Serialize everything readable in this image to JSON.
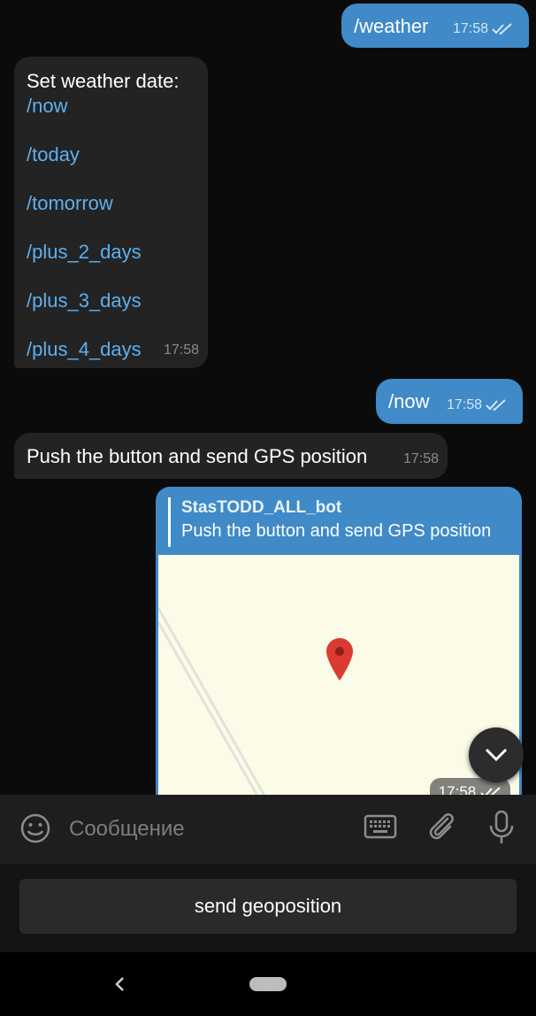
{
  "messages": {
    "m1": {
      "text": "/weather",
      "time": "17:58"
    },
    "m2": {
      "title": "Set weather date:",
      "commands": [
        "/now",
        "/today",
        "/tomorrow",
        "/plus_2_days",
        "/plus_3_days",
        "/plus_4_days"
      ],
      "time": "17:58"
    },
    "m3": {
      "text": "/now",
      "time": "17:58"
    },
    "m4": {
      "text": "Push the button and send GPS position",
      "time": "17:58"
    },
    "m5": {
      "reply_name": "StasTODD_ALL_bot",
      "reply_text": "Push the button and send GPS position",
      "time": "17:58"
    }
  },
  "composer": {
    "placeholder": "Сообщение"
  },
  "keyboard": {
    "button_label": "send geoposition"
  },
  "colors": {
    "outgoing_bubble": "#3f8ac7",
    "incoming_bubble": "#232323",
    "command_link": "#5eb0f0",
    "map_pin": "#d93b30"
  },
  "icons": [
    "emoji-icon",
    "keyboard-icon",
    "attach-icon",
    "microphone-icon",
    "chevron-down-icon",
    "read-ticks-icon",
    "map-pin-icon",
    "back-icon"
  ]
}
